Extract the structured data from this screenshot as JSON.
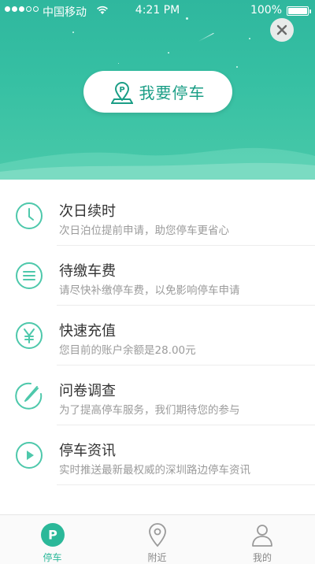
{
  "status_bar": {
    "carrier": "中国移动",
    "time": "4:21 PM",
    "battery": "100%"
  },
  "hero": {
    "park_button_label": "我要停车"
  },
  "menu": [
    {
      "title": "次日续时",
      "subtitle": "次日泊位提前申请，助您停车更省心",
      "icon": "clock-icon"
    },
    {
      "title": "待缴车费",
      "subtitle": "请尽快补缴停车费，以免影响停车申请",
      "icon": "list-icon"
    },
    {
      "title": "快速充值",
      "subtitle": "您目前的账户余额是28.00元",
      "icon": "yen-icon"
    },
    {
      "title": "问卷调查",
      "subtitle": "为了提高停车服务，我们期待您的参与",
      "icon": "pen-icon"
    },
    {
      "title": "停车资讯",
      "subtitle": "实时推送最新最权威的深圳路边停车资讯",
      "icon": "play-icon"
    }
  ],
  "tabs": [
    {
      "label": "停车",
      "icon": "parking-icon"
    },
    {
      "label": "附近",
      "icon": "location-pin-icon"
    },
    {
      "label": "我的",
      "icon": "user-icon"
    }
  ],
  "colors": {
    "accent": "#2bb899",
    "hero_top": "#2fb79e",
    "hero_bottom": "#49c9a9",
    "text_primary": "#333333",
    "text_secondary": "#9b9b9b"
  }
}
